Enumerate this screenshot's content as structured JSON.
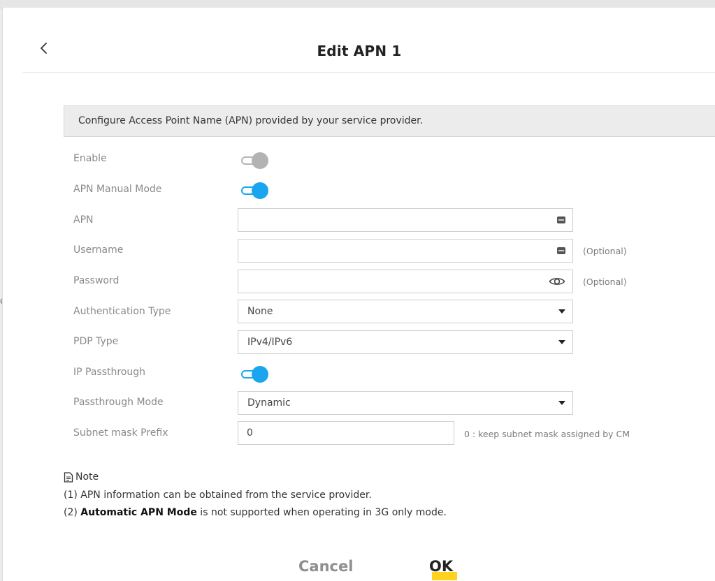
{
  "page": {
    "title": "Edit APN 1"
  },
  "info": "Configure Access Point Name (APN) provided by your service provider.",
  "form": {
    "enable": {
      "label": "Enable",
      "on": false
    },
    "apn_manual_mode": {
      "label": "APN Manual Mode",
      "on": true
    },
    "apn": {
      "label": "APN",
      "value": ""
    },
    "username": {
      "label": "Username",
      "value": "",
      "hint": "(Optional)"
    },
    "password": {
      "label": "Password",
      "value": "",
      "hint": "(Optional)"
    },
    "auth_type": {
      "label": "Authentication Type",
      "value": "None"
    },
    "pdp_type": {
      "label": "PDP Type",
      "value": "IPv4/IPv6"
    },
    "ip_passthrough": {
      "label": "IP Passthrough",
      "on": true
    },
    "passthrough_mode": {
      "label": "Passthrough Mode",
      "value": "Dynamic"
    },
    "subnet_mask_prefix": {
      "label": "Subnet mask Prefix",
      "value": "0",
      "hint": "0 : keep subnet mask assigned by CM"
    }
  },
  "note": {
    "title": "Note",
    "line1": "(1) APN information can be obtained from the service provider.",
    "line2_prefix": "(2) ",
    "line2_bold": "Automatic APN Mode",
    "line2_suffix": " is not supported when operating in 3G only mode."
  },
  "buttons": {
    "cancel": "Cancel",
    "ok": "OK"
  },
  "side_marker": "o",
  "colors": {
    "accent": "#1aa6ef",
    "toggle_off": "#b3b3b3",
    "ok_highlight": "#ffd21f"
  }
}
